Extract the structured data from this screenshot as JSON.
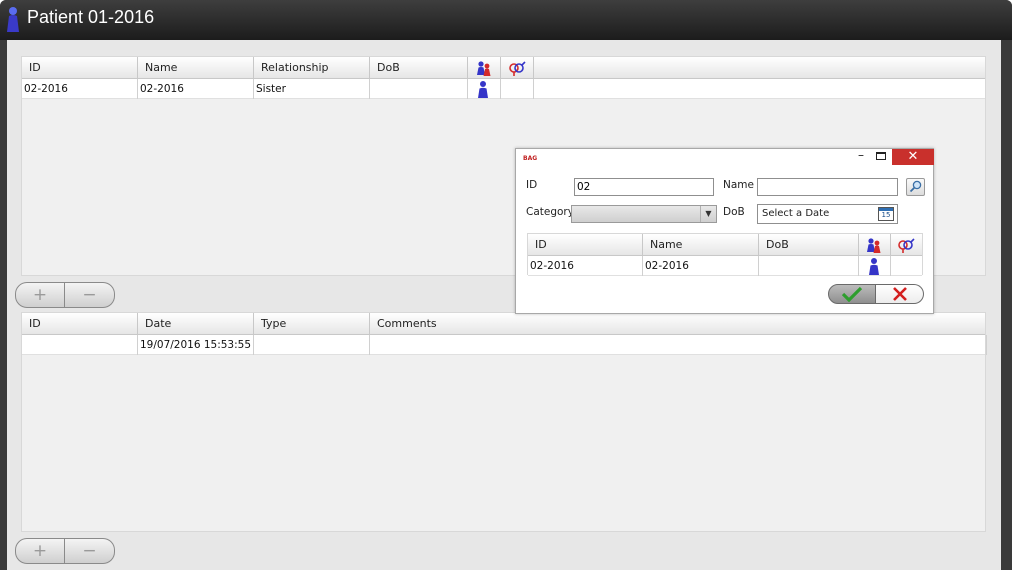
{
  "window": {
    "title": "Patient 01-2016",
    "icon": "person-icon"
  },
  "relatives_grid": {
    "columns": [
      "ID",
      "Name",
      "Relationship",
      "DoB"
    ],
    "icon_columns": [
      "male-female-people-icon",
      "gender-symbol-icon"
    ],
    "rows": [
      {
        "id": "02-2016",
        "name": "02-2016",
        "relationship": "Sister",
        "dob": "",
        "person_icon": "blue-person-icon"
      }
    ]
  },
  "relatives_buttons": {
    "add": "+",
    "remove": "−"
  },
  "visits_grid": {
    "columns": [
      "ID",
      "Date",
      "Type",
      "Comments"
    ],
    "rows": [
      {
        "id": "",
        "date": "19/07/2016 15:53:55",
        "type": "",
        "comments": ""
      }
    ]
  },
  "visits_buttons": {
    "add": "+",
    "remove": "−"
  },
  "dialog": {
    "title": "BAG",
    "minimize": "–",
    "close": "✕",
    "id_label": "ID",
    "id_value": "02",
    "name_label": "Name",
    "name_value": "",
    "category_label": "Category",
    "category_value": "",
    "dob_label": "DoB",
    "dob_placeholder": "Select a Date",
    "calendar_day": "15",
    "results": {
      "columns": [
        "ID",
        "Name",
        "DoB"
      ],
      "rows": [
        {
          "id": "02-2016",
          "name": "02-2016",
          "dob": ""
        }
      ]
    }
  },
  "colors": {
    "title_bar": "#1c1c1c",
    "close_button": "#c9302c",
    "ok_check": "#2e9e2e",
    "cancel_x": "#d41f1f",
    "person_blue": "#3535c8"
  }
}
